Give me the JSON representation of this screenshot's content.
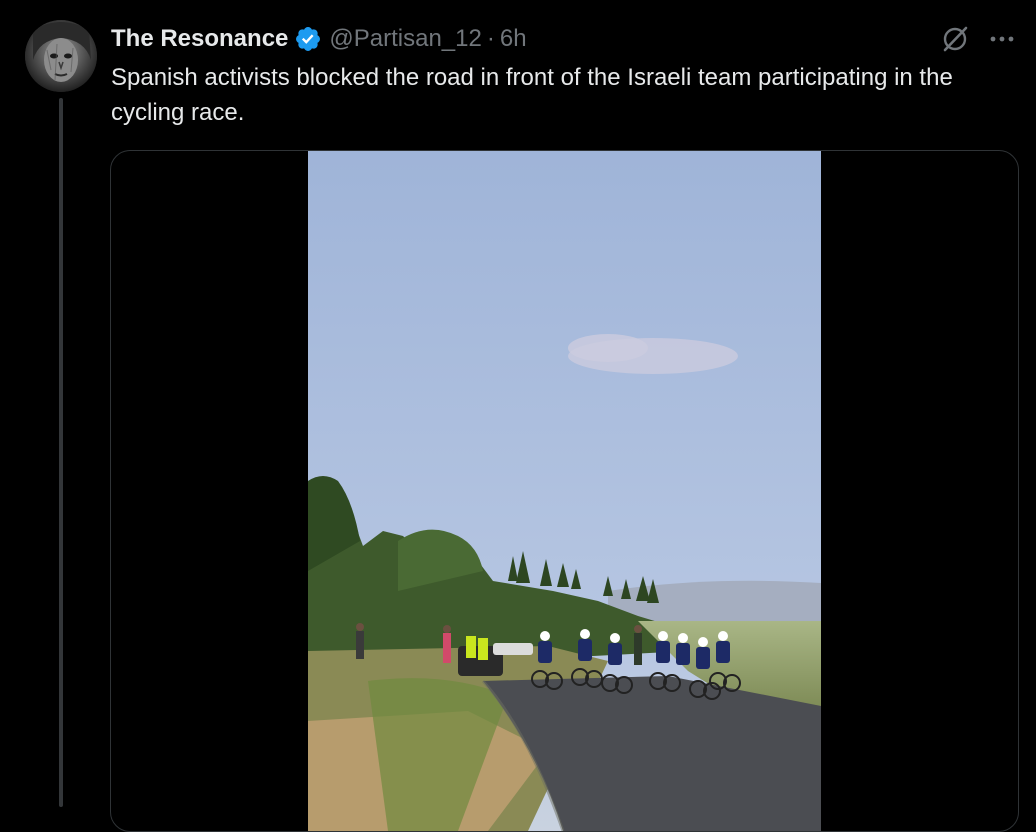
{
  "post": {
    "display_name": "The Resonance",
    "verified": true,
    "handle": "@Partisan_12",
    "separator": "·",
    "time": "6h",
    "text": "Spanish activists blocked the road in front of the Israeli team participating in the cycling race."
  },
  "icons": {
    "avatar": "avatar",
    "verified": "verified-badge-icon",
    "grok": "grok-icon",
    "more": "more-options-icon"
  },
  "colors": {
    "background": "#000000",
    "text_primary": "#e7e9ea",
    "text_secondary": "#71767b",
    "verified_blue": "#1d9bf0",
    "border": "#2f3336"
  }
}
